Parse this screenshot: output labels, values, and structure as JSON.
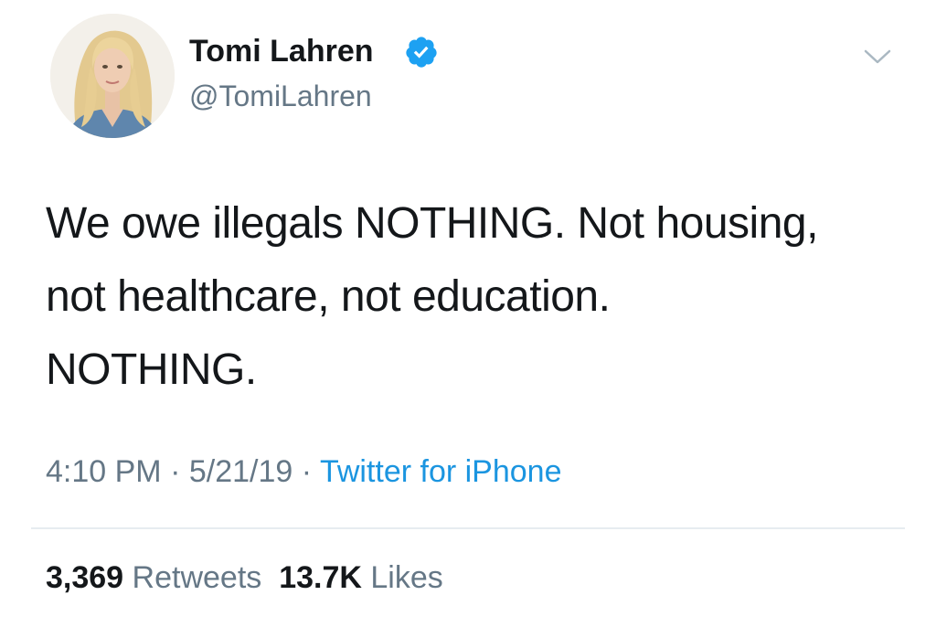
{
  "author": {
    "display_name": "Tomi Lahren",
    "handle": "@TomiLahren",
    "verified": true
  },
  "tweet": {
    "text_lines": [
      "We owe illegals NOTHING. Not housing,",
      "not healthcare, not education.",
      "NOTHING."
    ]
  },
  "meta": {
    "time": "4:10 PM",
    "separator": "·",
    "date": "5/21/19",
    "source": "Twitter for iPhone"
  },
  "stats": {
    "retweets_count": "3,369",
    "retweets_label": "Retweets",
    "likes_count": "13.7K",
    "likes_label": "Likes"
  },
  "icons": {
    "verified": "verified-badge-icon",
    "menu": "chevron-down-icon"
  },
  "colors": {
    "text": "#14171a",
    "secondary": "#657786",
    "link": "#1b95e0",
    "verified": "#1da1f2",
    "divider": "#e6ecf0"
  }
}
